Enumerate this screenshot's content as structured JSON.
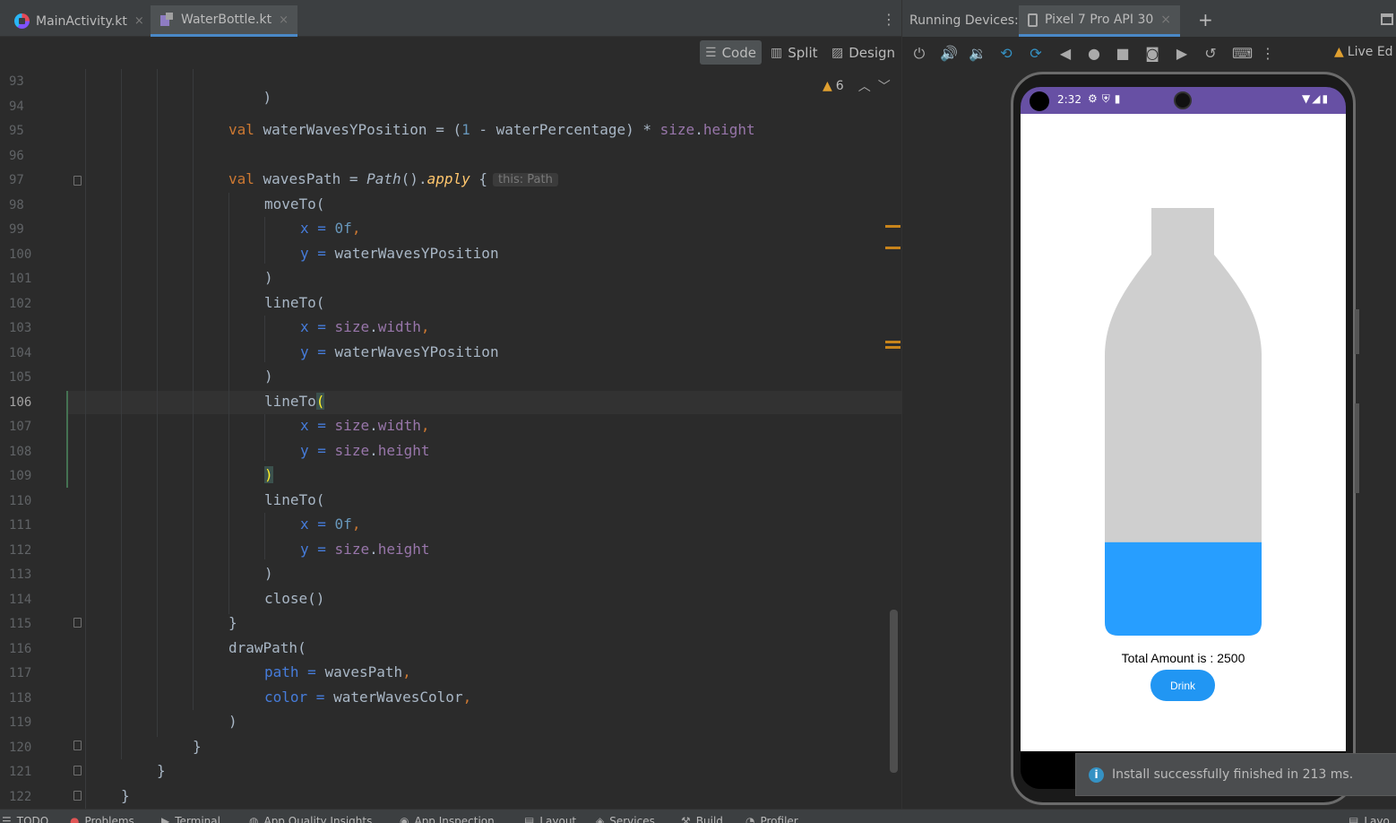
{
  "editor": {
    "tabs": [
      {
        "label": "MainActivity.kt",
        "close": "×"
      },
      {
        "label": "WaterBottle.kt",
        "close": "×"
      }
    ],
    "menu_glyph": "⋮",
    "view_modes": [
      "Code",
      "Split",
      "Design"
    ],
    "inspection": {
      "count": "6"
    },
    "lines": [
      {
        "no": "93"
      },
      {
        "no": "94"
      },
      {
        "no": "95"
      },
      {
        "no": "96"
      },
      {
        "no": "97"
      },
      {
        "no": "98"
      },
      {
        "no": "99"
      },
      {
        "no": "100"
      },
      {
        "no": "101"
      },
      {
        "no": "102"
      },
      {
        "no": "103"
      },
      {
        "no": "104"
      },
      {
        "no": "105"
      },
      {
        "no": "106"
      },
      {
        "no": "107"
      },
      {
        "no": "108"
      },
      {
        "no": "109"
      },
      {
        "no": "110"
      },
      {
        "no": "111"
      },
      {
        "no": "112"
      },
      {
        "no": "113"
      },
      {
        "no": "114"
      },
      {
        "no": "115"
      },
      {
        "no": "116"
      },
      {
        "no": "117"
      },
      {
        "no": "118"
      },
      {
        "no": "119"
      },
      {
        "no": "120"
      },
      {
        "no": "121"
      },
      {
        "no": "122"
      }
    ],
    "code": {
      "l93": ")",
      "l95_kw": "val",
      "l95_var": " waterWavesYPosition = (",
      "l95_num": "1",
      "l95_mid": " - waterPercentage) * ",
      "l95_prop1": "size",
      "l95_dot": ".",
      "l95_prop2": "height",
      "l97_kw": "val",
      "l97_var": " wavesPath = ",
      "l97_cls": "Path",
      "l97_paren": "().",
      "l97_fn": "apply",
      "l97_brace": " {",
      "l97_hint": "this: Path",
      "moveTo": "moveTo(",
      "lineTo": "lineTo(",
      "lineTo_name": "lineTo",
      "paren_open": "(",
      "close_paren": ")",
      "p_x": "x",
      "p_y": "y",
      "eq": " = ",
      "zero": "0f",
      "comma": ",",
      "wy": "waterWavesYPosition",
      "size": "size",
      "dot": ".",
      "width": "width",
      "height": "height",
      "close_call": "close()",
      "rbrace": "}",
      "drawPath": "drawPath(",
      "p_path": "path",
      "wavesPath": "wavesPath",
      "p_color": "color",
      "waterColor": "waterWavesColor"
    }
  },
  "devices": {
    "label": "Running Devices:",
    "tab": "Pixel 7 Pro API 30",
    "tab_close": "×",
    "add": "+",
    "live_edit": "Live Ed",
    "toolbar_icons": [
      "power-icon",
      "volume-up-icon",
      "volume-down-icon",
      "rotate-left-icon",
      "rotate-right-icon",
      "back-icon",
      "home-icon",
      "overview-icon",
      "screenshot-icon",
      "screen-record-icon",
      "reset-icon",
      "keyboard-icon",
      "more-icon"
    ]
  },
  "phone": {
    "time": "2:32",
    "app": {
      "water_level": 0.22,
      "bottle_color": "#cfcfcf",
      "water_color": "#279eff",
      "total_text": "Total Amount is : 2500",
      "button_label": "Drink",
      "button_color": "#2196f3"
    }
  },
  "toast": {
    "message": "Install successfully finished in 213 ms."
  },
  "bottom_tools": [
    "TODO",
    "Problems",
    "Terminal",
    "App Quality Insights",
    "App Inspection",
    "Layout",
    "Services",
    "Build",
    "Profiler",
    "Layo"
  ]
}
